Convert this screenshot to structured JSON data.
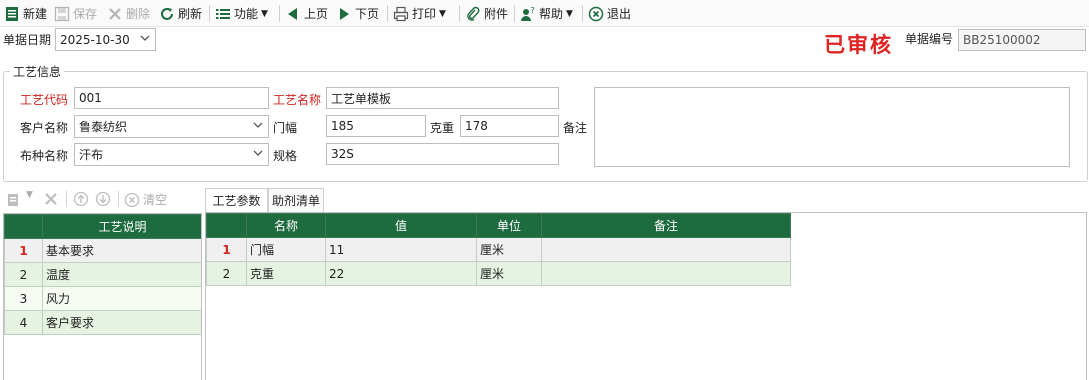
{
  "toolbar": {
    "new": "新建",
    "save": "保存",
    "delete": "删除",
    "refresh": "刷新",
    "function": "功能",
    "prev": "上页",
    "next": "下页",
    "print": "打印",
    "attach": "附件",
    "help": "帮助",
    "exit": "退出"
  },
  "header": {
    "date_label": "单据日期",
    "date_value": "2025-10-30",
    "stamp": "已审核",
    "docno_label": "单据编号",
    "docno_value": "BB25100002"
  },
  "craft": {
    "group_title": "工艺信息",
    "code_label": "工艺代码",
    "code_value": "001",
    "name_label": "工艺名称",
    "name_value": "工艺单模板",
    "customer_label": "客户名称",
    "customer_value": "鲁泰纺织",
    "width_label": "门幅",
    "width_value": "185",
    "weight_label": "克重",
    "weight_value": "178",
    "remark_label": "备注",
    "remark_value": "",
    "fabric_label": "布种名称",
    "fabric_value": "汗布",
    "spec_label": "规格",
    "spec_value": "32S"
  },
  "left_toolbar": {
    "clear": "清空"
  },
  "left_table": {
    "header": "工艺说明",
    "rows": [
      {
        "num": "1",
        "text": "基本要求"
      },
      {
        "num": "2",
        "text": "温度"
      },
      {
        "num": "3",
        "text": "风力"
      },
      {
        "num": "4",
        "text": "客户要求"
      }
    ]
  },
  "tabs": {
    "params": "工艺参数",
    "chemicals": "助剂清单"
  },
  "param_table": {
    "headers": {
      "name": "名称",
      "value": "值",
      "unit": "单位",
      "remark": "备注"
    },
    "rows": [
      {
        "num": "1",
        "name": "门幅",
        "value": "11",
        "unit": "厘米",
        "remark": ""
      },
      {
        "num": "2",
        "name": "克重",
        "value": "22",
        "unit": "厘米",
        "remark": ""
      }
    ]
  },
  "colors": {
    "header_green": "#1e6b3f",
    "required_red": "#d0221e",
    "stamp_red": "#e02222"
  }
}
